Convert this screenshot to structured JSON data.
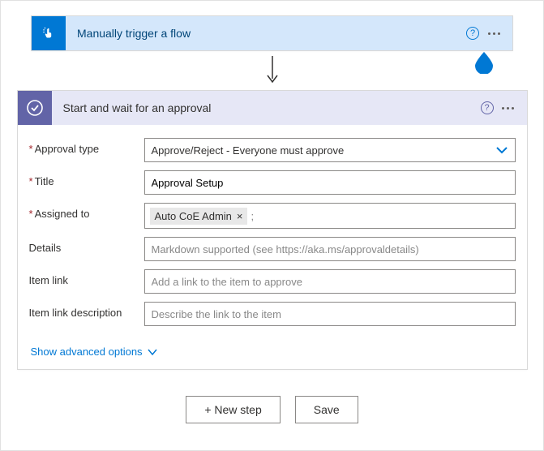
{
  "trigger": {
    "title": "Manually trigger a flow"
  },
  "approval": {
    "title": "Start and wait for an approval",
    "fields": {
      "approval_type": {
        "label": "Approval type",
        "value": "Approve/Reject - Everyone must approve"
      },
      "title": {
        "label": "Title",
        "value": "Approval Setup"
      },
      "assigned_to": {
        "label": "Assigned to",
        "chip": "Auto CoE Admin"
      },
      "details": {
        "label": "Details",
        "placeholder": "Markdown supported (see https://aka.ms/approvaldetails)"
      },
      "item_link": {
        "label": "Item link",
        "placeholder": "Add a link to the item to approve"
      },
      "item_link_desc": {
        "label": "Item link description",
        "placeholder": "Describe the link to the item"
      }
    },
    "advanced_link": "Show advanced options"
  },
  "footer": {
    "new_step": "+ New step",
    "save": "Save"
  }
}
